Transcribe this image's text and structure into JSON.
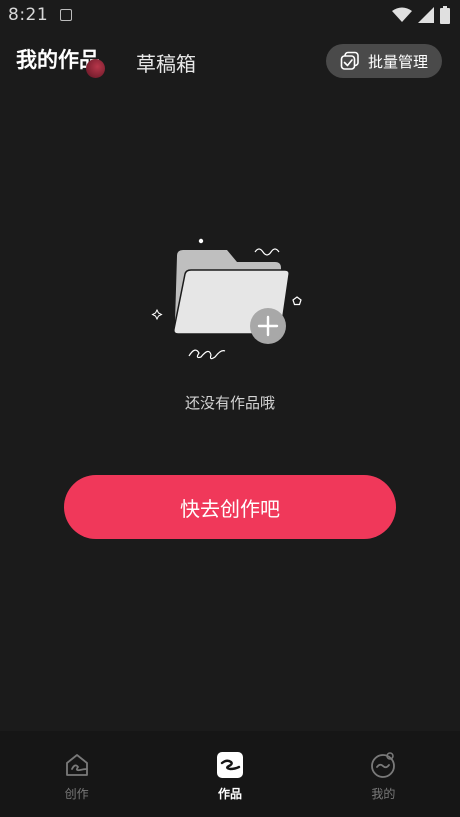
{
  "status_bar": {
    "time": "8:21"
  },
  "header": {
    "tabs": [
      {
        "label": "我的作品",
        "active": true
      },
      {
        "label": "草稿箱",
        "active": false
      }
    ],
    "batch_manage_label": "批量管理"
  },
  "empty_state": {
    "message": "还没有作品哦",
    "cta_label": "快去创作吧"
  },
  "bottom_nav": {
    "items": [
      {
        "label": "创作",
        "icon": "house-scribble-icon",
        "active": false
      },
      {
        "label": "作品",
        "icon": "works-scribble-icon",
        "active": true
      },
      {
        "label": "我的",
        "icon": "profile-circle-icon",
        "active": false
      }
    ]
  },
  "colors": {
    "background": "#1b1b1b",
    "accent": "#f0385a",
    "button_gray": "#4a4a4a"
  }
}
